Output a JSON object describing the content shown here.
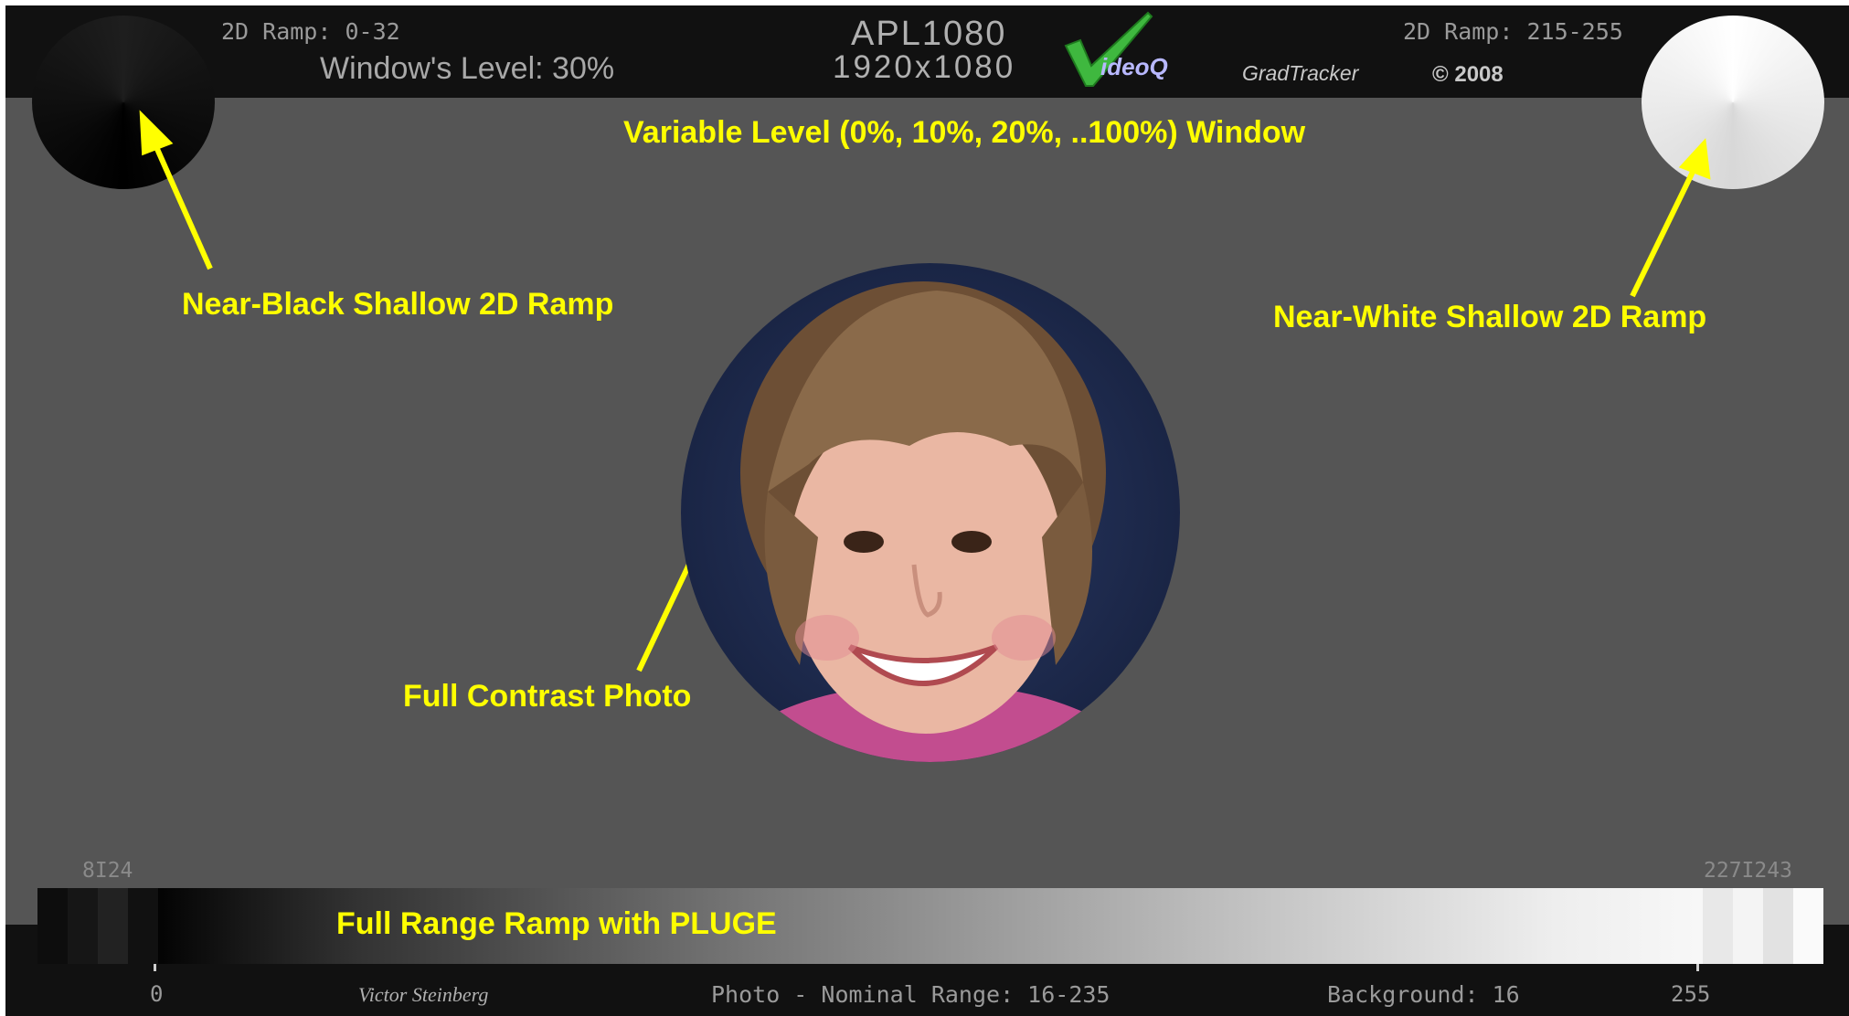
{
  "header": {
    "left_ramp_label": "2D Ramp: 0-32",
    "window_level": "Window's Level: 30%",
    "pattern_name": "APL1080",
    "resolution": "1920x1080",
    "logo_text": "ideoQ",
    "product": "GradTracker",
    "copyright": "© 2008",
    "right_ramp_label": "2D Ramp: 215-255"
  },
  "annotations": {
    "window_caption": "Variable Level (0%, 10%, 20%, ..100%) Window",
    "near_black": "Near-Black Shallow 2D Ramp",
    "near_white": "Near-White Shallow 2D Ramp",
    "photo": "Full Contrast Photo",
    "ramp": "Full Range Ramp with PLUGE"
  },
  "ramp": {
    "low_marker": "8I24",
    "high_marker": "227I243",
    "min_value": "0",
    "max_value": "255"
  },
  "footer": {
    "author": "Victor Steinberg",
    "photo_range": "Photo - Nominal Range: 16-235",
    "background": "Background: 16"
  },
  "colors": {
    "background_gray": "#555555",
    "bar_black": "#111111",
    "annotation_yellow": "#ffff00",
    "logo_check_green": "#3fb83f",
    "logo_red": "#d62020"
  }
}
